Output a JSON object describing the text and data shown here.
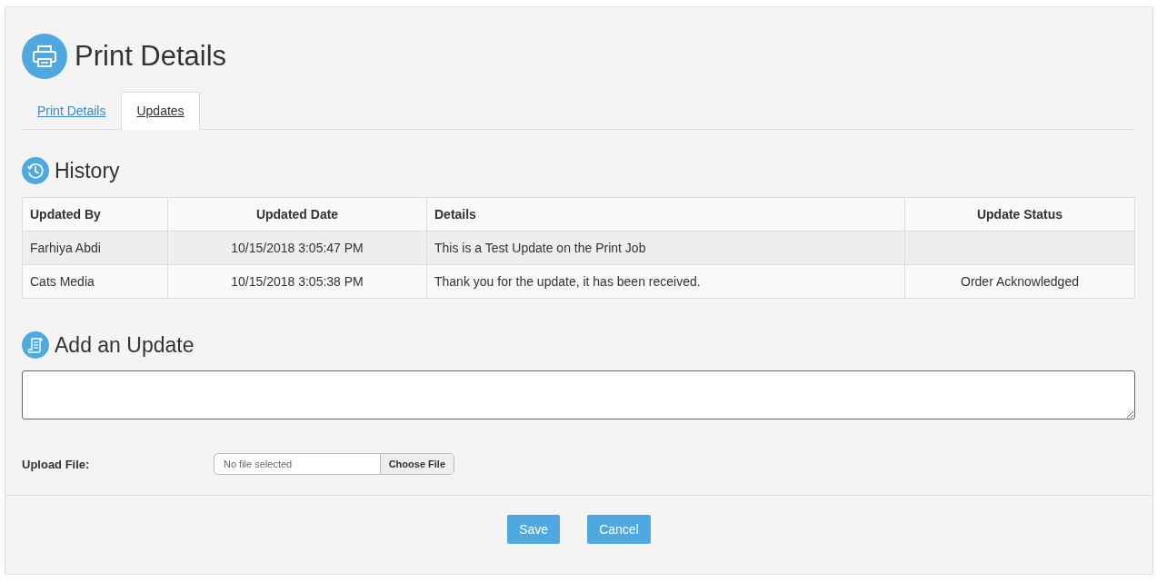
{
  "page_title": "Print Details",
  "tabs": [
    {
      "label": "Print Details",
      "selected": false
    },
    {
      "label": "Updates",
      "selected": true
    }
  ],
  "history": {
    "title": "History",
    "columns": [
      "Updated By",
      "Updated Date",
      "Details",
      "Update Status"
    ],
    "rows": [
      {
        "updated_by": "Farhiya Abdi",
        "updated_date": "10/15/2018 3:05:47 PM",
        "details": "This is a Test Update on the Print Job",
        "update_status": ""
      },
      {
        "updated_by": "Cats Media",
        "updated_date": "10/15/2018 3:05:38 PM",
        "details": "Thank you for the update, it has been received.",
        "update_status": "Order Acknowledged"
      }
    ]
  },
  "add_update": {
    "title": "Add an Update",
    "upload_label": "Upload File:",
    "file_status": "No file selected",
    "choose_button": "Choose File"
  },
  "buttons": [
    "Save",
    "Cancel"
  ]
}
